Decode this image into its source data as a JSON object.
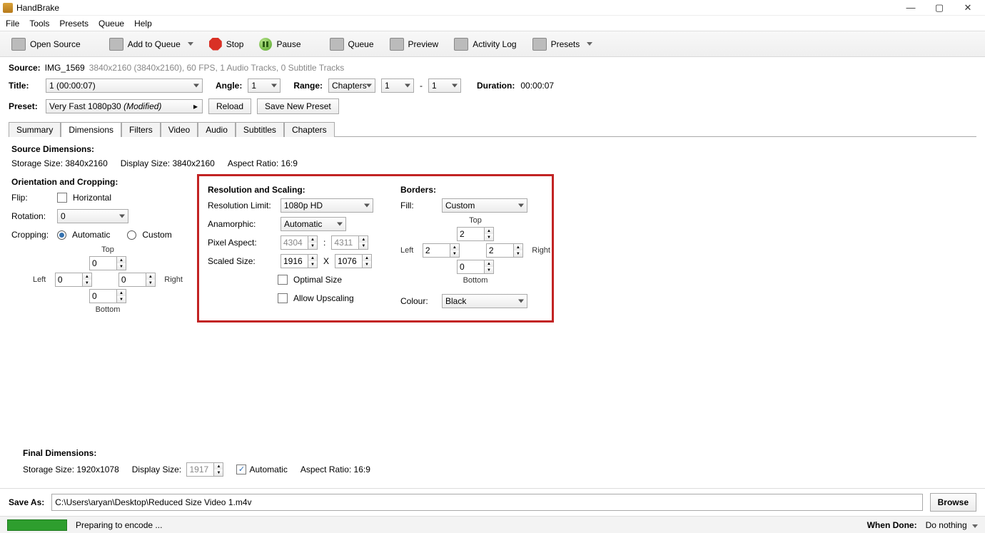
{
  "app_title": "HandBrake",
  "menus": [
    "File",
    "Tools",
    "Presets",
    "Queue",
    "Help"
  ],
  "toolbar": {
    "open_source": "Open Source",
    "add_queue": "Add to Queue",
    "stop": "Stop",
    "pause": "Pause",
    "queue": "Queue",
    "preview": "Preview",
    "activity": "Activity Log",
    "presets": "Presets"
  },
  "source": {
    "label": "Source:",
    "name": "IMG_1569",
    "info": "3840x2160 (3840x2160), 60 FPS, 1 Audio Tracks, 0 Subtitle Tracks"
  },
  "title_row": {
    "title_lbl": "Title:",
    "title_val": "1  (00:00:07)",
    "angle_lbl": "Angle:",
    "angle_val": "1",
    "range_lbl": "Range:",
    "range_type": "Chapters",
    "range_from": "1",
    "range_to": "1",
    "dash": "-",
    "duration_lbl": "Duration:",
    "duration_val": "00:00:07"
  },
  "preset_row": {
    "label": "Preset:",
    "name": "Very Fast 1080p30",
    "mod": "(Modified)",
    "reload": "Reload",
    "save_new": "Save New Preset"
  },
  "tabs": [
    "Summary",
    "Dimensions",
    "Filters",
    "Video",
    "Audio",
    "Subtitles",
    "Chapters"
  ],
  "active_tab": "Dimensions",
  "source_dims": {
    "heading": "Source Dimensions:",
    "storage": "Storage Size: 3840x2160",
    "display": "Display Size: 3840x2160",
    "aspect": "Aspect Ratio: 16:9"
  },
  "orient": {
    "heading": "Orientation and Cropping:",
    "flip_lbl": "Flip:",
    "flip_opt": "Horizontal",
    "rot_lbl": "Rotation:",
    "rot_val": "0",
    "crop_lbl": "Cropping:",
    "crop_auto": "Automatic",
    "crop_custom": "Custom",
    "top": "Top",
    "left": "Left",
    "right": "Right",
    "bottom": "Bottom",
    "v_top": "0",
    "v_left": "0",
    "v_right": "0",
    "v_bottom": "0"
  },
  "res": {
    "heading": "Resolution and Scaling:",
    "limit_lbl": "Resolution Limit:",
    "limit_val": "1080p HD",
    "ana_lbl": "Anamorphic:",
    "ana_val": "Automatic",
    "pa_lbl": "Pixel Aspect:",
    "pa_a": "4304",
    "pa_sep": ":",
    "pa_b": "4311",
    "scaled_lbl": "Scaled Size:",
    "sw": "1916",
    "x": "X",
    "sh": "1076",
    "opt": "Optimal Size",
    "upscale": "Allow Upscaling"
  },
  "borders": {
    "heading": "Borders:",
    "fill_lbl": "Fill:",
    "fill_val": "Custom",
    "top": "Top",
    "left": "Left",
    "right": "Right",
    "bottom": "Bottom",
    "v_top": "2",
    "v_left": "2",
    "v_right": "2",
    "v_bottom": "0",
    "colour_lbl": "Colour:",
    "colour_val": "Black"
  },
  "final_dims": {
    "heading": "Final Dimensions:",
    "storage": "Storage Size: 1920x1078",
    "display_lbl": "Display Size:",
    "display_val": "1917",
    "auto": "Automatic",
    "aspect": "Aspect Ratio: 16:9"
  },
  "saveas": {
    "label": "Save As:",
    "path": "C:\\Users\\aryan\\Desktop\\Reduced Size Video 1.m4v",
    "browse": "Browse"
  },
  "status": {
    "msg": "Preparing to encode ...",
    "done_lbl": "When Done:",
    "done_val": "Do nothing"
  }
}
